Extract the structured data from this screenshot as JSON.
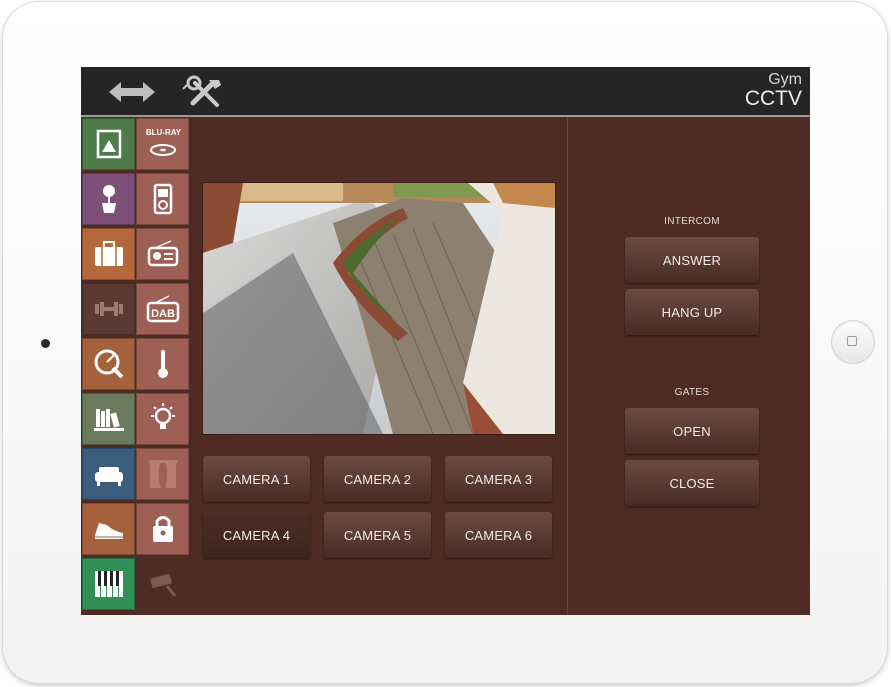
{
  "header": {
    "room": "Gym",
    "page_title": "CCTV",
    "icons": [
      "resize-arrows-icon",
      "tools-icon"
    ]
  },
  "sidebar": {
    "tiles": [
      {
        "icon": "picture-frame-icon",
        "color": "#4f7a4a"
      },
      {
        "icon": "bluray-icon",
        "label": "BLU-RAY",
        "color": "#9e5f55"
      },
      {
        "icon": "flower-pot-icon",
        "color": "#7c5078"
      },
      {
        "icon": "ipod-icon",
        "color": "#9e5f55"
      },
      {
        "icon": "suitcase-icon",
        "color": "#b5683c"
      },
      {
        "icon": "radio-icon",
        "color": "#9e5f55"
      },
      {
        "icon": "dumbbell-icon",
        "color": "#5a3a32"
      },
      {
        "icon": "dab-radio-icon",
        "label": "DAB",
        "color": "#9e5f55"
      },
      {
        "icon": "satellite-dish-icon",
        "color": "#a5603c"
      },
      {
        "icon": "thermometer-icon",
        "color": "#9e5f55"
      },
      {
        "icon": "bookshelf-icon",
        "color": "#6b7a5c"
      },
      {
        "icon": "light-bulb-icon",
        "color": "#9e5f55"
      },
      {
        "icon": "sofa-icon",
        "color": "#3b5d7d"
      },
      {
        "icon": "curtains-icon",
        "color": "#9e5f55"
      },
      {
        "icon": "sneaker-icon",
        "color": "#a5603c"
      },
      {
        "icon": "padlock-icon",
        "color": "#9e5f55"
      },
      {
        "icon": "piano-keys-icon",
        "color": "#2f8f55"
      },
      {
        "icon": "cctv-camera-icon",
        "color": "#4e2c24"
      }
    ]
  },
  "cameras": {
    "buttons": [
      "CAMERA 1",
      "CAMERA 2",
      "CAMERA 3",
      "CAMERA 4",
      "CAMERA 5",
      "CAMERA 6"
    ]
  },
  "intercom": {
    "label": "INTERCOM",
    "answer": "ANSWER",
    "hang_up": "HANG UP"
  },
  "gates": {
    "label": "GATES",
    "open": "OPEN",
    "close": "CLOSE"
  },
  "colors": {
    "background": "#4e2c24",
    "topbar": "#252525",
    "button": "#5b3a32"
  }
}
